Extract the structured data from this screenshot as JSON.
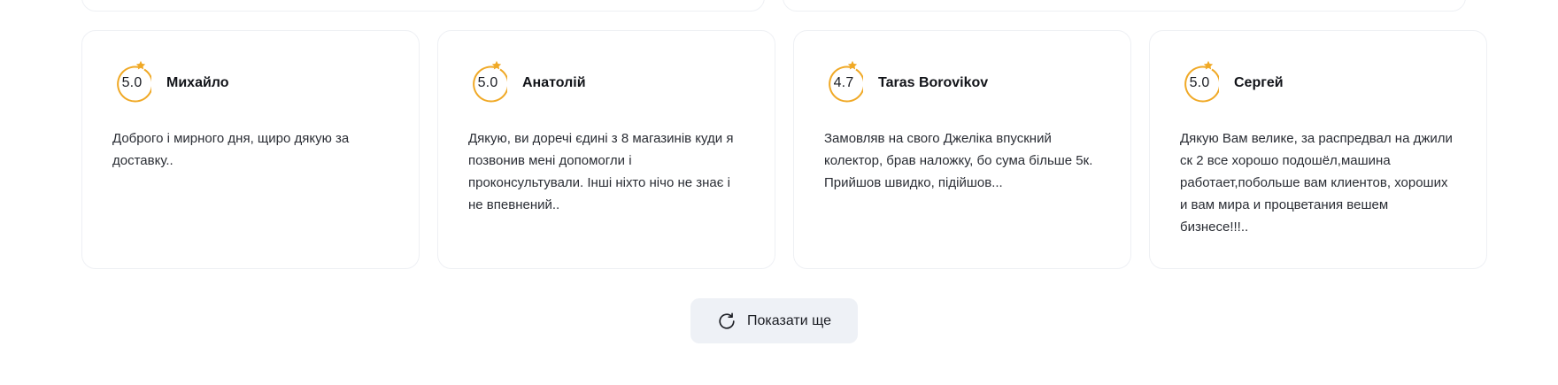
{
  "colors": {
    "accent_star": "#f0a926",
    "card_border": "#eef0f4",
    "button_bg": "#eef1f6"
  },
  "reviews": [
    {
      "rating": "5.0",
      "author": "Михайло",
      "text": "Доброго і мирного дня, щиро дякую за доставку.."
    },
    {
      "rating": "5.0",
      "author": "Анатолій",
      "text": "Дякую, ви доречі єдині з 8 магазинів куди я позвонив мені допомогли і проконсультували. Інші ніхто нічо не знає і не впевнений.."
    },
    {
      "rating": "4.7",
      "author": "Taras Borovikov",
      "text": "Замовляв на свого Джеліка впускний колектор, брав наложку, бо сума більше 5к. Прийшов швидко, підійшов..."
    },
    {
      "rating": "5.0",
      "author": "Сергей",
      "text": "Дякую Вам велике, за распредвал на джили ск 2 все хорошо подошёл,машина работает,побольше вам клиентов, хороших и вам мира и процветания вешем бизнесе!!!.."
    }
  ],
  "show_more": {
    "label": "Показати ще",
    "icon": "refresh-icon"
  }
}
